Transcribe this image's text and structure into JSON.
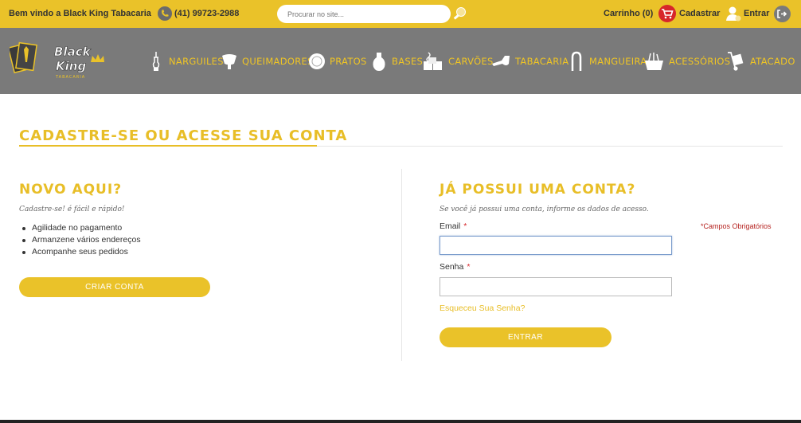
{
  "topbar": {
    "welcome": "Bem vindo a Black King Tabacaria",
    "phone": "(41) 99723-2988",
    "search_placeholder": "Procurar no site...",
    "cart_label": "Carrinho (0)",
    "signup_label": "Cadastrar",
    "login_label": "Entrar"
  },
  "logo": {
    "line1": "Black",
    "line2": "King",
    "line3": "TABACARIA"
  },
  "nav": [
    {
      "label": "NARGUILES",
      "icon": "hookah-icon"
    },
    {
      "label": "QUEIMADORES",
      "icon": "burner-icon"
    },
    {
      "label": "PRATOS",
      "icon": "plate-icon"
    },
    {
      "label": "BASES",
      "icon": "base-icon"
    },
    {
      "label": "CARVÕES",
      "icon": "charcoal-icon"
    },
    {
      "label": "TABACARIA",
      "icon": "pipe-icon"
    },
    {
      "label": "MANGUEIRA",
      "icon": "hose-icon"
    },
    {
      "label": "ACESSÓRIOS",
      "icon": "accessories-icon"
    },
    {
      "label": "ATACADO",
      "icon": "handtruck-icon"
    }
  ],
  "page": {
    "title": "CADASTRE-SE OU ACESSE SUA CONTA"
  },
  "new_customer": {
    "heading": "NOVO AQUI?",
    "subtitle": "Cadastre-se! é fácil e rápido!",
    "benefits": [
      "Agilidade no pagamento",
      "Armanzene vários endereços",
      "Acompanhe seus pedidos"
    ],
    "button": "CRIAR CONTA"
  },
  "login": {
    "heading": "JÁ POSSUI UMA CONTA?",
    "subtitle": "Se você já possui uma conta, informe os dados de acesso.",
    "required_note": "*Campos Obrigatórios",
    "email_label": "Email",
    "password_label": "Senha",
    "required_mark": "*",
    "email_value": "",
    "password_value": "",
    "forgot": "Esqueceu Sua Senha?",
    "button": "ENTRAR"
  },
  "colors": {
    "brand_yellow": "#eac229",
    "nav_gray": "#7a7a7a",
    "cart_red": "#d7262a"
  }
}
